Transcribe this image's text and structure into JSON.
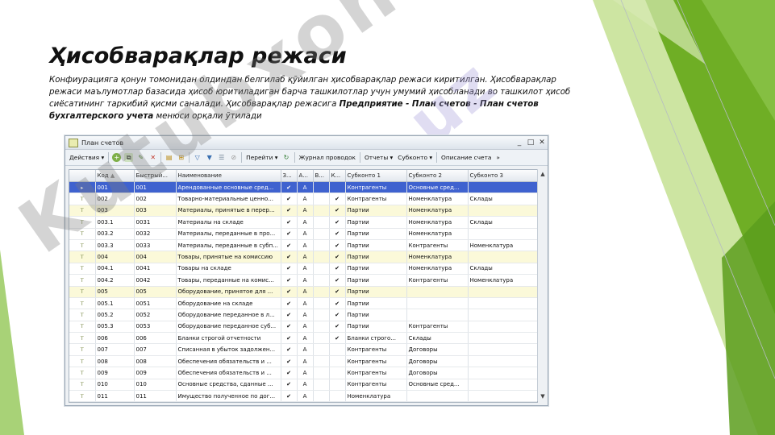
{
  "slide": {
    "title": "Ҳисобварақлар режаси",
    "body_parts": [
      "Конфиурацияга қонун томонидан олдиндан белгилаб қўйилган ҳисобварақлар режаси киритилган. Ҳисобварақлар режаси маълумотлар базасида ҳисоб юритиладиган барча ташкилотлар учун умумий ҳисобланади во ташкилот ҳисоб сиёсатининг таркибий қисми саналади. Ҳисобварақлар режасига ",
      "Предприятие - План счетов - План счетов бухгалтерского учета",
      " менюси орқали ўтилади"
    ],
    "watermark_text": "Kutubxona",
    "watermark_text_2": "uz"
  },
  "colors": {
    "accent_green": "#7ab51d",
    "light_green": "#c6e08a",
    "selected_row": "#3f62cf",
    "folder_row": "#fbf9d9"
  },
  "window": {
    "title": "План счетов",
    "buttons": {
      "minimize": "_",
      "maximize": "□",
      "close": "✕"
    },
    "toolbar": {
      "actions": "Действия ▾",
      "goto": "Перейти ▾",
      "journal": "Журнал проводок",
      "reports": "Отчеты ▾",
      "subconto": "Субконто ▾",
      "description": "Описание счета",
      "more": "»"
    },
    "columns": [
      "",
      "Код",
      "Быстрый...",
      "Наименование",
      "З...",
      "А...",
      "В...",
      "К...",
      "Субконто 1",
      "Субконто 2",
      "Субконто 3"
    ],
    "rows": [
      {
        "icon": "▸",
        "code": "001",
        "fast": "001",
        "name": "Арендованные основные сред...",
        "z": "✔",
        "a": "А",
        "v": "",
        "k": "",
        "s1": "Контрагенты",
        "s2": "Основные сред...",
        "s3": "",
        "type": "sel"
      },
      {
        "icon": "Т",
        "code": "002",
        "fast": "002",
        "name": "Товарно-материальные ценно...",
        "z": "✔",
        "a": "А",
        "v": "",
        "k": "✔",
        "s1": "Контрагенты",
        "s2": "Номенклатура",
        "s3": "Склады",
        "type": ""
      },
      {
        "icon": "Т",
        "code": "003",
        "fast": "003",
        "name": "Материалы, принятые в перер...",
        "z": "✔",
        "a": "А",
        "v": "",
        "k": "✔",
        "s1": "Партии",
        "s2": "Номенклатура",
        "s3": "",
        "type": "folder"
      },
      {
        "icon": "Т",
        "code": "003.1",
        "fast": "0031",
        "name": "Материалы на складе",
        "z": "✔",
        "a": "А",
        "v": "",
        "k": "✔",
        "s1": "Партии",
        "s2": "Номенклатура",
        "s3": "Склады",
        "type": ""
      },
      {
        "icon": "Т",
        "code": "003.2",
        "fast": "0032",
        "name": "Материалы, переданные в про...",
        "z": "✔",
        "a": "А",
        "v": "",
        "k": "✔",
        "s1": "Партии",
        "s2": "Номенклатура",
        "s3": "",
        "type": ""
      },
      {
        "icon": "Т",
        "code": "003.3",
        "fast": "0033",
        "name": "Материалы, переданные в субп...",
        "z": "✔",
        "a": "А",
        "v": "",
        "k": "✔",
        "s1": "Партии",
        "s2": "Контрагенты",
        "s3": "Номенклатура",
        "type": ""
      },
      {
        "icon": "Т",
        "code": "004",
        "fast": "004",
        "name": "Товары, принятые на комиссию",
        "z": "✔",
        "a": "А",
        "v": "",
        "k": "✔",
        "s1": "Партии",
        "s2": "Номенклатура",
        "s3": "",
        "type": "folder"
      },
      {
        "icon": "Т",
        "code": "004.1",
        "fast": "0041",
        "name": "Товары на складе",
        "z": "✔",
        "a": "А",
        "v": "",
        "k": "✔",
        "s1": "Партии",
        "s2": "Номенклатура",
        "s3": "Склады",
        "type": ""
      },
      {
        "icon": "Т",
        "code": "004.2",
        "fast": "0042",
        "name": "Товары, переданные на комис...",
        "z": "✔",
        "a": "А",
        "v": "",
        "k": "✔",
        "s1": "Партии",
        "s2": "Контрагенты",
        "s3": "Номенклатура",
        "type": ""
      },
      {
        "icon": "Т",
        "code": "005",
        "fast": "005",
        "name": "Оборудование, принятое для ...",
        "z": "✔",
        "a": "А",
        "v": "",
        "k": "✔",
        "s1": "Партии",
        "s2": "",
        "s3": "",
        "type": "folder"
      },
      {
        "icon": "Т",
        "code": "005.1",
        "fast": "0051",
        "name": "Оборудование на складе",
        "z": "✔",
        "a": "А",
        "v": "",
        "k": "✔",
        "s1": "Партии",
        "s2": "",
        "s3": "",
        "type": ""
      },
      {
        "icon": "Т",
        "code": "005.2",
        "fast": "0052",
        "name": "Оборудование переданное в л...",
        "z": "✔",
        "a": "А",
        "v": "",
        "k": "✔",
        "s1": "Партии",
        "s2": "",
        "s3": "",
        "type": ""
      },
      {
        "icon": "Т",
        "code": "005.3",
        "fast": "0053",
        "name": "Оборудование переданное суб...",
        "z": "✔",
        "a": "А",
        "v": "",
        "k": "✔",
        "s1": "Партии",
        "s2": "Контрагенты",
        "s3": "",
        "type": ""
      },
      {
        "icon": "Т",
        "code": "006",
        "fast": "006",
        "name": "Бланки строгой отчетности",
        "z": "✔",
        "a": "А",
        "v": "",
        "k": "✔",
        "s1": "Бланки строго...",
        "s2": "Склады",
        "s3": "",
        "type": ""
      },
      {
        "icon": "Т",
        "code": "007",
        "fast": "007",
        "name": "Списанная в убыток задолжен...",
        "z": "✔",
        "a": "А",
        "v": "",
        "k": "",
        "s1": "Контрагенты",
        "s2": "Договоры",
        "s3": "",
        "type": ""
      },
      {
        "icon": "Т",
        "code": "008",
        "fast": "008",
        "name": "Обеспечения обязательств и ...",
        "z": "✔",
        "a": "А",
        "v": "",
        "k": "",
        "s1": "Контрагенты",
        "s2": "Договоры",
        "s3": "",
        "type": ""
      },
      {
        "icon": "Т",
        "code": "009",
        "fast": "009",
        "name": "Обеспечения обязательств и ...",
        "z": "✔",
        "a": "А",
        "v": "",
        "k": "",
        "s1": "Контрагенты",
        "s2": "Договоры",
        "s3": "",
        "type": ""
      },
      {
        "icon": "Т",
        "code": "010",
        "fast": "010",
        "name": "Основные средства, сданные ...",
        "z": "✔",
        "a": "А",
        "v": "",
        "k": "",
        "s1": "Контрагенты",
        "s2": "Основные сред...",
        "s3": "",
        "type": ""
      },
      {
        "icon": "Т",
        "code": "011",
        "fast": "011",
        "name": "Имущество полученное по дог...",
        "z": "✔",
        "a": "А",
        "v": "",
        "k": "",
        "s1": "Номенклатура",
        "s2": "",
        "s3": "",
        "type": ""
      }
    ]
  }
}
